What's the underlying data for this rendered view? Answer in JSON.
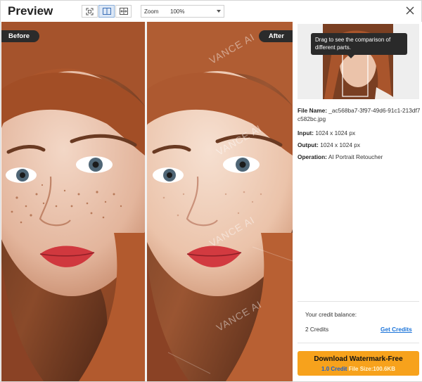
{
  "header": {
    "title": "Preview",
    "view_buttons": [
      {
        "icon": "fit-screen-icon"
      },
      {
        "icon": "side-by-side-icon",
        "active": true
      },
      {
        "icon": "slider-compare-icon"
      }
    ],
    "zoom": {
      "label": "Zoom",
      "value": "100%"
    },
    "close_icon": "close-icon"
  },
  "panes": {
    "before_label": "Before",
    "after_label": "After",
    "watermark": "VANCE AI"
  },
  "side": {
    "tooltip": "Drag to see the comparison of different parts.",
    "file_name_label": "File Name:",
    "file_name_value": "_ac568ba7-3f97-49d6-91c1-213df7c582bc.jpg",
    "input_label": "Input:",
    "input_value": "1024 x 1024 px",
    "output_label": "Output:",
    "output_value": "1024 x 1024 px",
    "operation_label": "Operation:",
    "operation_value": "AI Portrait Retoucher",
    "credit_balance_label": "Your credit balance:",
    "credit_count": "2 Credits",
    "get_credits": "Get Credits",
    "download_title": "Download Watermark-Free",
    "download_credit": "1.0 Credit",
    "download_size": "File Size:100.6KB"
  },
  "colors": {
    "accent_orange": "#f7a21c",
    "link_blue": "#1a73d9",
    "tag_dark": "#2b2b2b"
  }
}
